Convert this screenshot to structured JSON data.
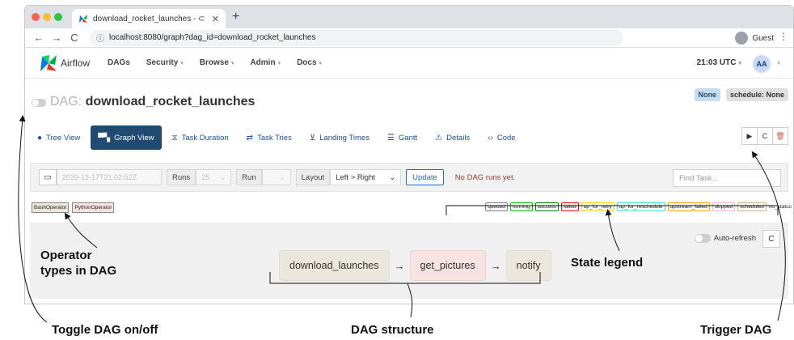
{
  "browser": {
    "tab_title": "download_rocket_launches - ⊂",
    "tab_close": "✕",
    "new_tab": "+",
    "url_host": "localhost:",
    "url_path": "8080/graph?dag_id=download_rocket_launches",
    "guest_label": "Guest",
    "back": "←",
    "forward": "→",
    "reload": "C",
    "info": "ⓘ",
    "menu": "⋮"
  },
  "navbar": {
    "logo_text": "Airflow",
    "items": [
      {
        "label": "DAGs"
      },
      {
        "label": "Security"
      },
      {
        "label": "Browse"
      },
      {
        "label": "Admin"
      },
      {
        "label": "Docs"
      }
    ],
    "time": "21:03 UTC",
    "user_initials": "AA"
  },
  "dag": {
    "prefix": "DAG:",
    "name": "download_rocket_launches",
    "badge_none": "None",
    "badge_schedule": "schedule: None"
  },
  "view_tabs": [
    {
      "label": "Tree View",
      "icon": "●"
    },
    {
      "label": "Graph View",
      "icon": "▀▚"
    },
    {
      "label": "Task Duration",
      "icon": "⧖"
    },
    {
      "label": "Task Tries",
      "icon": "⇄"
    },
    {
      "label": "Landing Times",
      "icon": "⊻"
    },
    {
      "label": "Gantt",
      "icon": "☰"
    },
    {
      "label": "Details",
      "icon": "⚠"
    },
    {
      "label": "Code",
      "icon": "‹›"
    }
  ],
  "actions": {
    "trigger": "▶",
    "refresh": "C",
    "delete": "🗑"
  },
  "controls": {
    "date_value": "2020-12-17T21:02:52Z",
    "runs_label": "Runs",
    "runs_value": "25",
    "run_label": "Run",
    "layout_label": "Layout",
    "layout_value": "Left > Right",
    "update_label": "Update",
    "no_runs": "No DAG runs yet.",
    "find_placeholder": "Find Task..."
  },
  "operator_legend": [
    "BashOperator",
    "PythonOperator"
  ],
  "state_legend": [
    {
      "label": "queued",
      "color": "#808080"
    },
    {
      "label": "running",
      "color": "#00c000"
    },
    {
      "label": "success",
      "color": "#008000"
    },
    {
      "label": "failed",
      "color": "#ff0000"
    },
    {
      "label": "up_for_retry",
      "color": "#ffd700"
    },
    {
      "label": "up_for_reschedule",
      "color": "#40e0d0"
    },
    {
      "label": "upstream_failed",
      "color": "#ffa500"
    },
    {
      "label": "skipped",
      "color": "#ffb6c1"
    },
    {
      "label": "scheduled",
      "color": "#d2b48c"
    },
    {
      "label": "no_status",
      "color": "#ffffff"
    }
  ],
  "graph": {
    "auto_refresh": "Auto-refresh",
    "refresh": "C",
    "nodes": [
      {
        "label": "download_launches",
        "type": "bash"
      },
      {
        "label": "get_pictures",
        "type": "python"
      },
      {
        "label": "notify",
        "type": "bash"
      }
    ],
    "arrow": "→"
  },
  "annotations": {
    "operator_types": "Operator\ntypes in DAG",
    "state_legend": "State legend",
    "toggle": "Toggle DAG on/off",
    "dag_structure": "DAG structure",
    "trigger": "Trigger DAG"
  },
  "colors": {
    "active_tab": "#1f4b73",
    "bash_node": "#ece7dd",
    "python_node": "#f9e2e2"
  }
}
